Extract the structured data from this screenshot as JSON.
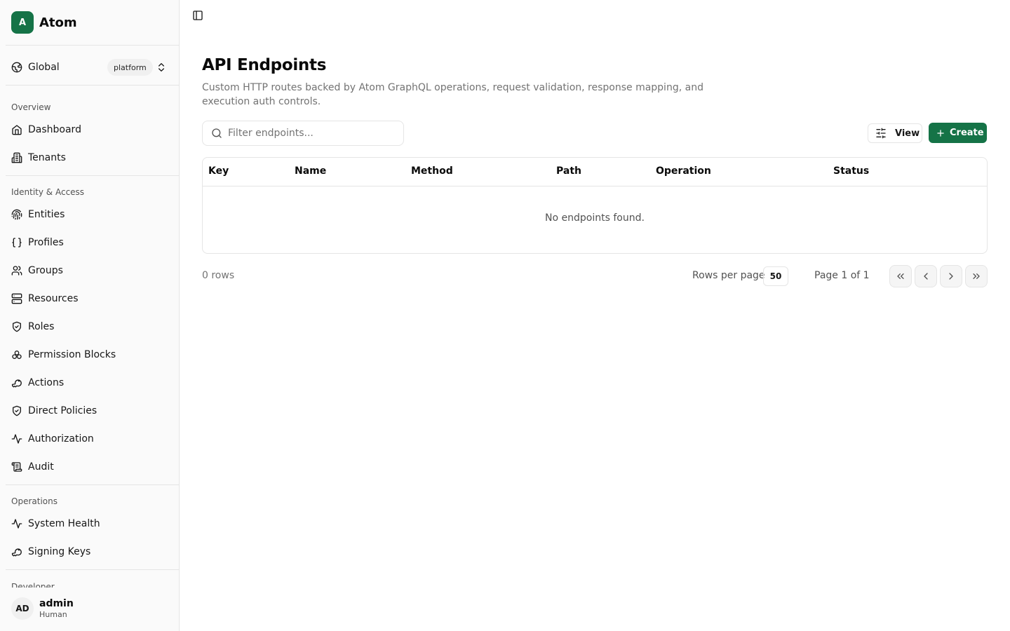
{
  "brand": {
    "logo_letter": "A",
    "name": "Atom",
    "accent": "#157347"
  },
  "scope": {
    "label": "Global",
    "badge": "platform"
  },
  "sidebar": {
    "groups": [
      {
        "label": "Overview",
        "items": [
          {
            "label": "Dashboard",
            "icon": "home-icon"
          },
          {
            "label": "Tenants",
            "icon": "building-icon"
          }
        ]
      },
      {
        "label": "Identity & Access",
        "items": [
          {
            "label": "Entities",
            "icon": "fingerprint-icon"
          },
          {
            "label": "Profiles",
            "icon": "braces-icon"
          },
          {
            "label": "Groups",
            "icon": "users-icon"
          },
          {
            "label": "Resources",
            "icon": "server-icon"
          },
          {
            "label": "Roles",
            "icon": "shield-check-icon"
          },
          {
            "label": "Permission Blocks",
            "icon": "blocks-icon"
          },
          {
            "label": "Actions",
            "icon": "key-icon"
          },
          {
            "label": "Direct Policies",
            "icon": "shield-check-icon"
          },
          {
            "label": "Authorization",
            "icon": "activity-icon"
          },
          {
            "label": "Audit",
            "icon": "scroll-icon"
          }
        ]
      },
      {
        "label": "Operations",
        "items": [
          {
            "label": "System Health",
            "icon": "activity-icon"
          },
          {
            "label": "Signing Keys",
            "icon": "key-icon"
          }
        ]
      },
      {
        "label": "Developer"
      }
    ]
  },
  "user": {
    "initials": "AD",
    "name": "admin",
    "role": "Human"
  },
  "page": {
    "title": "API Endpoints",
    "description": "Custom HTTP routes backed by Atom GraphQL operations, request validation, response mapping, and execution auth controls."
  },
  "toolbar": {
    "search_placeholder": "Filter endpoints...",
    "view_label": "View",
    "create_label": "Create"
  },
  "table": {
    "columns": [
      "Key",
      "Name",
      "Method",
      "Path",
      "Operation",
      "Status"
    ],
    "rows": [],
    "empty_text": "No endpoints found."
  },
  "pagination": {
    "row_count": "0 rows",
    "rows_per_page_label": "Rows per page",
    "rows_per_page": "50",
    "page_text": "Page 1 of 1"
  }
}
